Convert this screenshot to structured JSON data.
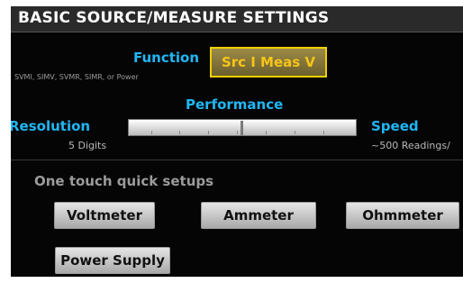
{
  "header": {
    "title": "BASIC SOURCE/MEASURE SETTINGS"
  },
  "function": {
    "label": "Function",
    "hint": "SVMI, SIMV, SVMR, SIMR, or Power",
    "value": "Src I Meas V"
  },
  "performance": {
    "label": "Performance",
    "left_label": "Resolution",
    "left_value": "5 Digits",
    "right_label": "Speed",
    "right_value": "~500 Readings/",
    "slider_position": 0.5
  },
  "quick_setups": {
    "label": "One touch quick setups",
    "buttons": [
      "Voltmeter",
      "Ammeter",
      "Ohmmeter",
      "Power Supply"
    ]
  },
  "colors": {
    "accent": "#21b6f5",
    "highlight": "#f0d000",
    "background": "#050505"
  }
}
